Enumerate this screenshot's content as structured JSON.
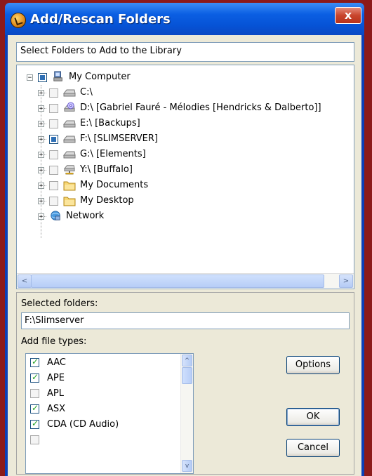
{
  "window": {
    "title": "Add/Rescan Folders",
    "close_glyph": "x"
  },
  "prompt": "Select Folders to Add to the Library",
  "tree": {
    "root": {
      "label": "My Computer",
      "icon": "computer-icon",
      "check": "partial"
    },
    "items": [
      {
        "label": "C:\\",
        "icon": "drive-icon",
        "check": "unchecked"
      },
      {
        "label": "D:\\ [Gabriel Fauré - Mélodies [Hendricks & Dalberto]]",
        "icon": "cd-drive-icon",
        "check": "unchecked"
      },
      {
        "label": "E:\\ [Backups]",
        "icon": "drive-icon",
        "check": "unchecked"
      },
      {
        "label": "F:\\ [SLIMSERVER]",
        "icon": "drive-icon",
        "check": "partial"
      },
      {
        "label": "G:\\ [Elements]",
        "icon": "drive-icon",
        "check": "unchecked"
      },
      {
        "label": "Y:\\ [Buffalo]",
        "icon": "network-drive-icon",
        "check": "unchecked"
      },
      {
        "label": "My Documents",
        "icon": "folder-icon",
        "check": "unchecked"
      },
      {
        "label": "My Desktop",
        "icon": "folder-icon",
        "check": "unchecked"
      }
    ],
    "network": {
      "label": "Network",
      "icon": "network-icon"
    }
  },
  "scroll": {
    "left_arrow": "<",
    "right_arrow": ">",
    "up_arrow": "^",
    "down_arrow": "v"
  },
  "selected_folders": {
    "label": "Selected folders:",
    "value": "F:\\Slimserver"
  },
  "file_types": {
    "label": "Add file types:",
    "items": [
      {
        "label": "AAC",
        "checked": true
      },
      {
        "label": "APE",
        "checked": true
      },
      {
        "label": "APL",
        "checked": false
      },
      {
        "label": "ASX",
        "checked": true
      },
      {
        "label": "CDA (CD Audio)",
        "checked": true
      }
    ]
  },
  "buttons": {
    "options": "Options",
    "ok": "OK",
    "cancel": "Cancel"
  }
}
